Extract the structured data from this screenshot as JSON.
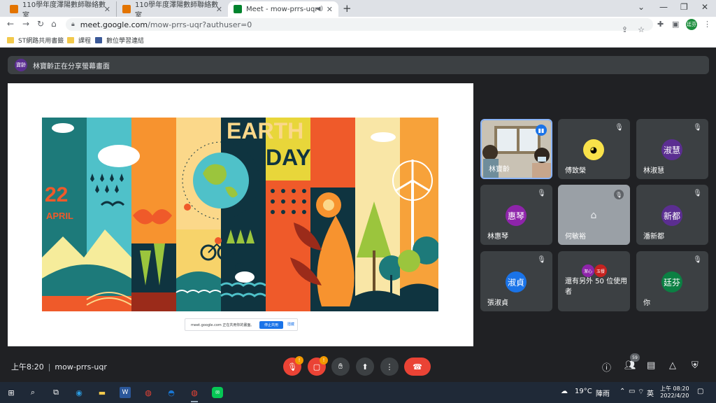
{
  "browser": {
    "tabs": [
      {
        "title": "110學年度澤陽數師聯絡數室",
        "active": false
      },
      {
        "title": "110學年度澤陽數師聯絡數室",
        "active": false
      },
      {
        "title": "Meet - mow-prrs-uqr",
        "active": true
      }
    ],
    "url_host": "meet.google.com",
    "url_path": "/mow-prrs-uqr?authuser=0",
    "profile_initials": "廷芬",
    "bookmarks": [
      "ST網路共用書籤",
      "課程",
      "數位學習連結"
    ]
  },
  "meet": {
    "banner": {
      "avatar": "寶齡",
      "text": "林寶齡正在分享螢幕畫面"
    },
    "presentation": {
      "poster_title_line1": "EARTH",
      "poster_title_line2": "DAY",
      "poster_date_number": "22",
      "poster_date_month": "APRIL",
      "share_notice": "meet.google.com 正在共用你的畫面。",
      "stop_share_label": "停止共用",
      "hide_label": "隱藏"
    },
    "participants": [
      {
        "name": "林寶齡",
        "type": "video",
        "speaking": true
      },
      {
        "name": "傅致榮",
        "type": "avatar-image",
        "avatar_color": "#f9e24a"
      },
      {
        "name": "林淑慧",
        "type": "avatar",
        "initials": "淑慧",
        "avatar_color": "#5b2e91"
      },
      {
        "name": "林惠琴",
        "type": "avatar",
        "initials": "惠琴",
        "avatar_color": "#8e24aa"
      },
      {
        "name": "何敏裕",
        "type": "placeholder"
      },
      {
        "name": "潘新都",
        "type": "avatar",
        "initials": "新都",
        "avatar_color": "#5b2e91"
      },
      {
        "name": "張淑貞",
        "type": "avatar",
        "initials": "淑貞",
        "avatar_color": "#1a73e8"
      },
      {
        "name": "還有另外 50 位使用者",
        "type": "group",
        "initials": [
          "潔心",
          "玉餐"
        ]
      },
      {
        "name": "你",
        "type": "avatar",
        "initials": "廷芬",
        "avatar_color": "#0b8043"
      }
    ],
    "bottom_bar": {
      "time": "上午8:20",
      "meeting_code": "mow-prrs-uqr",
      "people_count": "59"
    }
  },
  "taskbar": {
    "weather_temp": "19°C",
    "weather_text": "陣雨",
    "ime": "英",
    "clock_time": "上午 08:20",
    "clock_date": "2022/4/20"
  },
  "colors": {
    "meet_bg": "#202124",
    "tile_bg": "#3c4043",
    "hangup_red": "#ea4335",
    "accent_blue": "#1a73e8"
  }
}
